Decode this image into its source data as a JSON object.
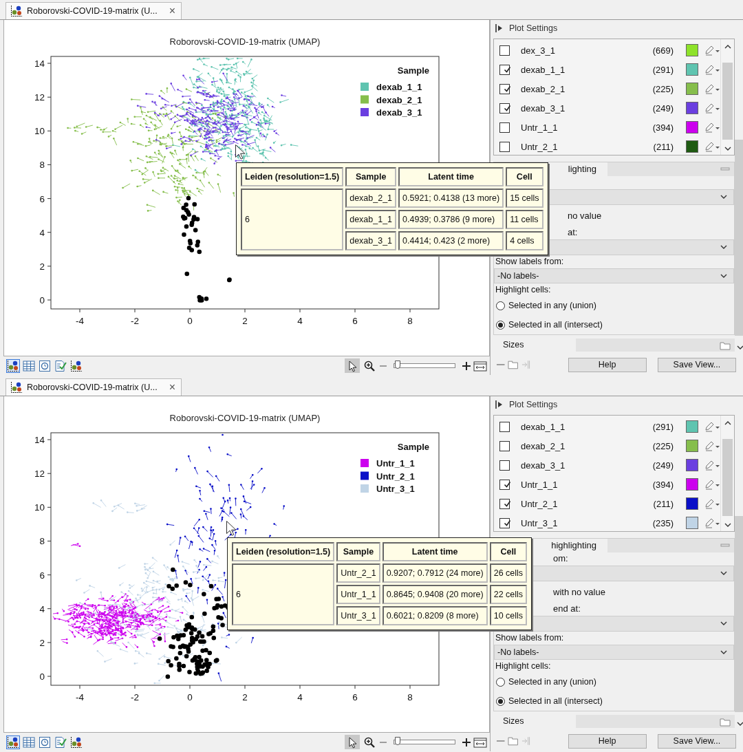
{
  "views": [
    {
      "tab": {
        "title": "Roborovski-COVID-19-matrix (U...",
        "close": "×"
      },
      "plot": {
        "title": "Roborovski-COVID-19-matrix (UMAP)",
        "xticks": [
          "-4",
          "-2",
          "0",
          "2",
          "4",
          "6",
          "8"
        ],
        "yticks": [
          "14",
          "12",
          "10",
          "8",
          "6",
          "4",
          "2",
          "0"
        ],
        "legend": {
          "title": "Sample",
          "items": [
            {
              "label": "dexab_1_1",
              "color": "#5fc4b0"
            },
            {
              "label": "dexab_2_1",
              "color": "#86be4c"
            },
            {
              "label": "dexab_3_1",
              "color": "#6b3fe0"
            }
          ]
        }
      },
      "tooltip": {
        "columns": [
          "Leiden (resolution=1.5)",
          "Sample",
          "Latent time",
          "Cell"
        ],
        "rows": [
          [
            "",
            "dexab_2_1",
            "0.5921; 0.4138 (13 more)",
            "15 cells"
          ],
          [
            "6",
            "dexab_1_1",
            "0.4939; 0.3786 (9 more)",
            "11 cells"
          ],
          [
            "",
            "dexab_3_1",
            "0.4414; 0.423 (2 more)",
            "4 cells"
          ]
        ]
      },
      "view_buttons": [
        {
          "kind": "scatter",
          "selected": true
        },
        {
          "kind": "table",
          "selected": false
        },
        {
          "kind": "gauge",
          "selected": false
        },
        {
          "kind": "checklist",
          "selected": false
        },
        {
          "kind": "scatter",
          "selected": false
        }
      ],
      "tools": [
        {
          "kind": "pointer",
          "selected": true
        },
        {
          "kind": "zoom",
          "selected": false
        }
      ],
      "zoom_slider": {
        "level": 0.03
      },
      "settings": {
        "title": "Plot Settings",
        "samples": [
          {
            "label": "dex_3_1",
            "count": "(669)",
            "color": "#8ee22a",
            "checked": false
          },
          {
            "label": "dexab_1_1",
            "count": "(291)",
            "color": "#5fc4b0",
            "checked": true
          },
          {
            "label": "dexab_2_1",
            "count": "(225)",
            "color": "#86be4c",
            "checked": true
          },
          {
            "label": "dexab_3_1",
            "count": "(249)",
            "color": "#6b3fe0",
            "checked": true
          },
          {
            "label": "Untr_1_1",
            "count": "(394)",
            "color": "#cc00ee",
            "checked": false
          },
          {
            "label": "Untr_2_1",
            "count": "(211)",
            "color": "#1f5a12",
            "checked": false
          }
        ],
        "section_tab": "lighting",
        "missing_label": "no value",
        "legend_label": "at:",
        "labels_label": "Show labels from:",
        "labels_value": "-No labels-",
        "highlight_label": "Highlight cells:",
        "highlight_options": [
          {
            "label": "Selected in any (union)",
            "selected": false
          },
          {
            "label": "Selected in all (intersect)",
            "selected": true
          }
        ],
        "sizes_tab": "Sizes",
        "buttons": [
          "Help",
          "Save View..."
        ]
      }
    },
    {
      "tab": {
        "title": "Roborovski-COVID-19-matrix (U...",
        "close": "×"
      },
      "plot": {
        "title": "Roborovski-COVID-19-matrix (UMAP)",
        "xticks": [
          "-4",
          "-2",
          "0",
          "2",
          "4",
          "6",
          "8"
        ],
        "yticks": [
          "14",
          "12",
          "10",
          "8",
          "6",
          "4",
          "2",
          "0"
        ],
        "legend": {
          "title": "Sample",
          "items": [
            {
              "label": "Untr_1_1",
              "color": "#cc00ee"
            },
            {
              "label": "Untr_2_1",
              "color": "#0a10c8"
            },
            {
              "label": "Untr_3_1",
              "color": "#c0d4e6"
            }
          ]
        }
      },
      "tooltip": {
        "columns": [
          "Leiden (resolution=1.5)",
          "Sample",
          "Latent time",
          "Cell"
        ],
        "rows": [
          [
            "",
            "Untr_2_1",
            "0.9207; 0.7912 (24 more)",
            "26 cells"
          ],
          [
            "6",
            "Untr_1_1",
            "0.8645; 0.9408 (20 more)",
            "22 cells"
          ],
          [
            "",
            "Untr_3_1",
            "0.6021; 0.8209 (8 more)",
            "10 cells"
          ]
        ]
      },
      "view_buttons": [
        {
          "kind": "scatter",
          "selected": true
        },
        {
          "kind": "table",
          "selected": false
        },
        {
          "kind": "gauge",
          "selected": false
        },
        {
          "kind": "checklist",
          "selected": false
        },
        {
          "kind": "scatter",
          "selected": false
        }
      ],
      "tools": [
        {
          "kind": "pointer",
          "selected": true
        },
        {
          "kind": "zoom",
          "selected": false
        }
      ],
      "zoom_slider": {
        "level": 0.03
      },
      "settings": {
        "title": "Plot Settings",
        "samples": [
          {
            "label": "dexab_1_1",
            "count": "(291)",
            "color": "#5fc4b0",
            "checked": false
          },
          {
            "label": "dexab_2_1",
            "count": "(225)",
            "color": "#86be4c",
            "checked": false
          },
          {
            "label": "dexab_3_1",
            "count": "(249)",
            "color": "#6b3fe0",
            "checked": false
          },
          {
            "label": "Untr_1_1",
            "count": "(394)",
            "color": "#cc00ee",
            "checked": true
          },
          {
            "label": "Untr_2_1",
            "count": "(211)",
            "color": "#0a10c8",
            "checked": true
          },
          {
            "label": "Untr_3_1",
            "count": "(235)",
            "color": "#c0d4e6",
            "checked": true
          }
        ],
        "section_tab": "highlighting",
        "source_label": "om:",
        "missing_label": "with no value",
        "legend_label": "end at:",
        "labels_label": "Show labels from:",
        "labels_value": "-No labels-",
        "highlight_label": "Highlight cells:",
        "highlight_options": [
          {
            "label": "Selected in any (union)",
            "selected": false
          },
          {
            "label": "Selected in all (intersect)",
            "selected": true
          }
        ],
        "sizes_tab": "Sizes",
        "buttons": [
          "Help",
          "Save View..."
        ]
      }
    }
  ]
}
